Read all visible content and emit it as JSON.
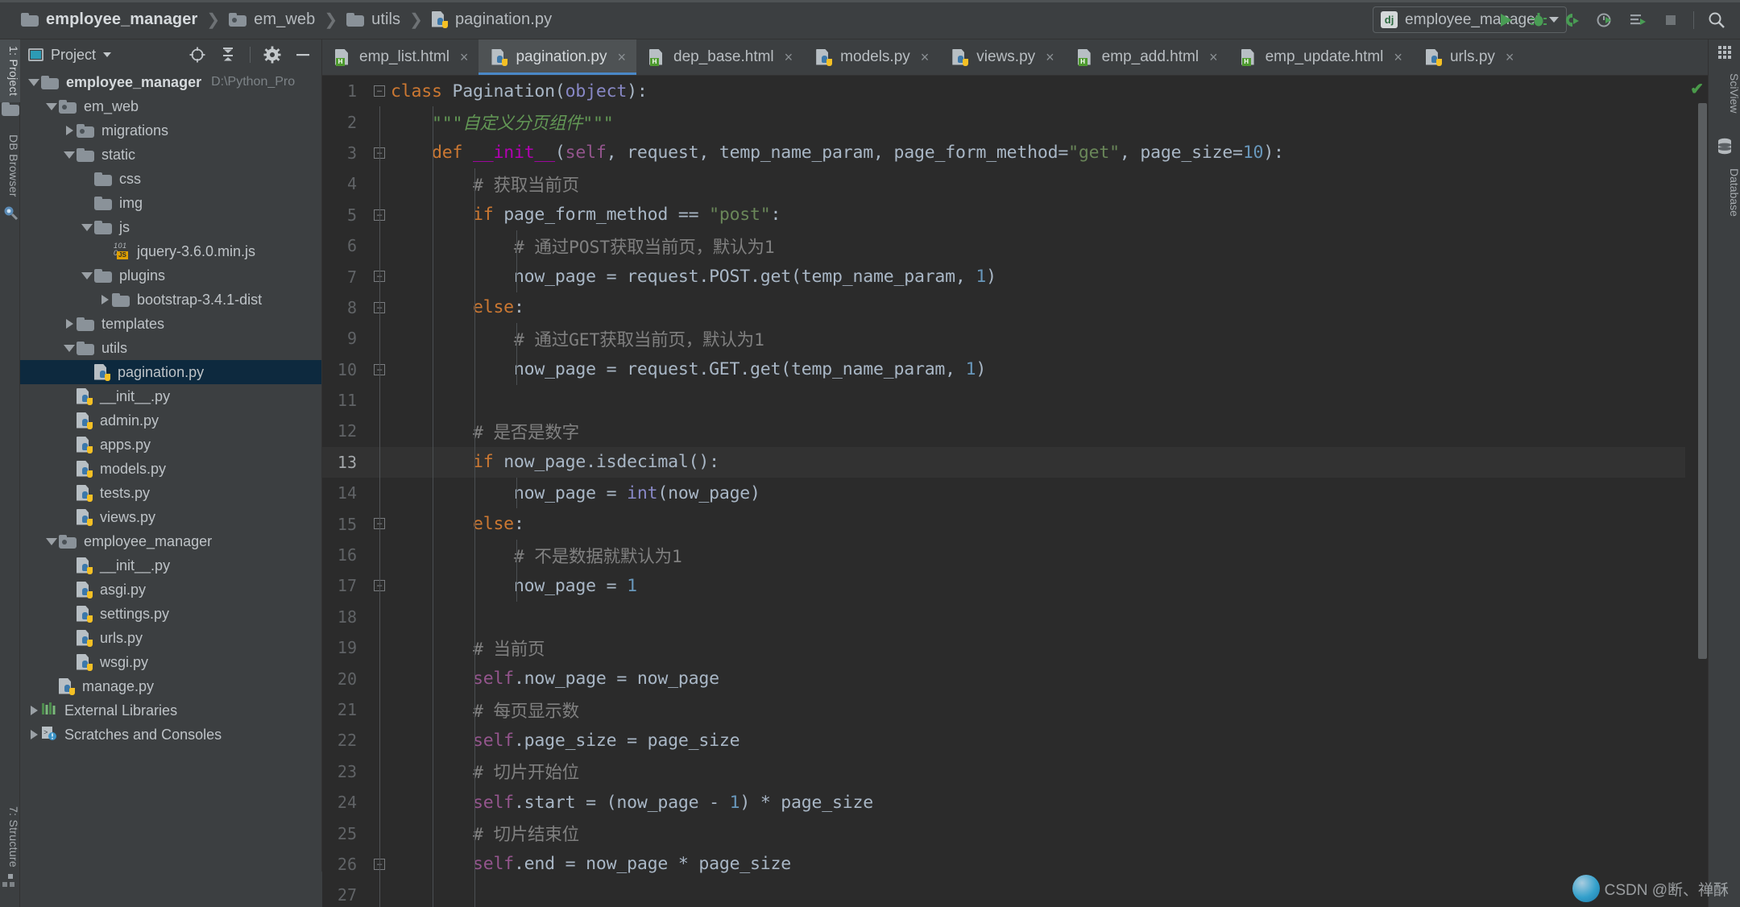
{
  "breadcrumb": {
    "items": [
      {
        "label": "employee_manager",
        "icon": "folder-icon"
      },
      {
        "label": "em_web",
        "icon": "module-folder-icon"
      },
      {
        "label": "utils",
        "icon": "folder-icon"
      },
      {
        "label": "pagination.py",
        "icon": "python-file-icon"
      }
    ],
    "separator": "❯"
  },
  "toolbar": {
    "run_config": {
      "badge": "dj",
      "name": "employee_manager",
      "dropdown": "▼"
    },
    "buttons": [
      {
        "name": "run-button",
        "glyph": "run"
      },
      {
        "name": "debug-button",
        "glyph": "debug"
      },
      {
        "name": "run-coverage-button",
        "glyph": "coverage"
      },
      {
        "name": "profile-button",
        "glyph": "profile"
      },
      {
        "name": "run-with-console-button",
        "glyph": "console"
      },
      {
        "name": "stop-button",
        "glyph": "stop"
      },
      {
        "name": "search-everywhere-button",
        "glyph": "search"
      }
    ]
  },
  "left_rail": {
    "top": [
      {
        "label": "1: Project",
        "active": true,
        "icon": "folder-icon"
      }
    ],
    "second": [
      {
        "label": "DB Browser",
        "active": false,
        "icon": "db-browser-icon"
      }
    ],
    "bottom": [
      {
        "label": "7: Structure",
        "active": false,
        "icon": "structure-icon"
      }
    ]
  },
  "right_rail": {
    "items": [
      {
        "label": "SciView",
        "icon": "grid-icon"
      },
      {
        "label": "Database",
        "icon": "database-icon"
      }
    ]
  },
  "project_panel": {
    "title": "Project",
    "dropdown": "▼",
    "tools": [
      {
        "name": "select-opened-file-icon",
        "glyph": "target"
      },
      {
        "name": "collapse-all-icon",
        "glyph": "collapse"
      },
      {
        "name": "settings-gear-icon",
        "glyph": "gear"
      },
      {
        "name": "hide-panel-icon",
        "glyph": "minus"
      }
    ],
    "tree": [
      {
        "label": "employee_manager",
        "path": "D:\\Python_Pro",
        "indent": 0,
        "twisty": "down",
        "icon": "folder-icon",
        "bold": true,
        "selected": false
      },
      {
        "label": "em_web",
        "path": "",
        "indent": 1,
        "twisty": "down",
        "icon": "module-folder-icon",
        "bold": false,
        "selected": false
      },
      {
        "label": "migrations",
        "path": "",
        "indent": 2,
        "twisty": "right",
        "icon": "module-folder-icon",
        "bold": false,
        "selected": false
      },
      {
        "label": "static",
        "path": "",
        "indent": 2,
        "twisty": "down",
        "icon": "folder-icon",
        "bold": false,
        "selected": false
      },
      {
        "label": "css",
        "path": "",
        "indent": 3,
        "twisty": "none",
        "icon": "folder-icon",
        "bold": false,
        "selected": false
      },
      {
        "label": "img",
        "path": "",
        "indent": 3,
        "twisty": "none",
        "icon": "folder-icon",
        "bold": false,
        "selected": false
      },
      {
        "label": "js",
        "path": "",
        "indent": 3,
        "twisty": "down",
        "icon": "folder-icon",
        "bold": false,
        "selected": false
      },
      {
        "label": "jquery-3.6.0.min.js",
        "path": "",
        "indent": 4,
        "twisty": "none",
        "icon": "js-file-icon",
        "bold": false,
        "selected": false
      },
      {
        "label": "plugins",
        "path": "",
        "indent": 3,
        "twisty": "down",
        "icon": "folder-icon",
        "bold": false,
        "selected": false
      },
      {
        "label": "bootstrap-3.4.1-dist",
        "path": "",
        "indent": 4,
        "twisty": "right",
        "icon": "folder-icon",
        "bold": false,
        "selected": false
      },
      {
        "label": "templates",
        "path": "",
        "indent": 2,
        "twisty": "right",
        "icon": "folder-icon",
        "bold": false,
        "selected": false
      },
      {
        "label": "utils",
        "path": "",
        "indent": 2,
        "twisty": "down",
        "icon": "folder-icon",
        "bold": false,
        "selected": false
      },
      {
        "label": "pagination.py",
        "path": "",
        "indent": 3,
        "twisty": "none",
        "icon": "python-file-icon",
        "bold": false,
        "selected": true
      },
      {
        "label": "__init__.py",
        "path": "",
        "indent": 2,
        "twisty": "none",
        "icon": "python-file-icon",
        "bold": false,
        "selected": false
      },
      {
        "label": "admin.py",
        "path": "",
        "indent": 2,
        "twisty": "none",
        "icon": "python-file-icon",
        "bold": false,
        "selected": false
      },
      {
        "label": "apps.py",
        "path": "",
        "indent": 2,
        "twisty": "none",
        "icon": "python-file-icon",
        "bold": false,
        "selected": false
      },
      {
        "label": "models.py",
        "path": "",
        "indent": 2,
        "twisty": "none",
        "icon": "python-file-icon",
        "bold": false,
        "selected": false
      },
      {
        "label": "tests.py",
        "path": "",
        "indent": 2,
        "twisty": "none",
        "icon": "python-file-icon",
        "bold": false,
        "selected": false
      },
      {
        "label": "views.py",
        "path": "",
        "indent": 2,
        "twisty": "none",
        "icon": "python-file-icon",
        "bold": false,
        "selected": false
      },
      {
        "label": "employee_manager",
        "path": "",
        "indent": 1,
        "twisty": "down",
        "icon": "module-folder-icon",
        "bold": false,
        "selected": false
      },
      {
        "label": "__init__.py",
        "path": "",
        "indent": 2,
        "twisty": "none",
        "icon": "python-file-icon",
        "bold": false,
        "selected": false
      },
      {
        "label": "asgi.py",
        "path": "",
        "indent": 2,
        "twisty": "none",
        "icon": "python-file-icon",
        "bold": false,
        "selected": false
      },
      {
        "label": "settings.py",
        "path": "",
        "indent": 2,
        "twisty": "none",
        "icon": "python-file-icon",
        "bold": false,
        "selected": false
      },
      {
        "label": "urls.py",
        "path": "",
        "indent": 2,
        "twisty": "none",
        "icon": "python-file-icon",
        "bold": false,
        "selected": false
      },
      {
        "label": "wsgi.py",
        "path": "",
        "indent": 2,
        "twisty": "none",
        "icon": "python-file-icon",
        "bold": false,
        "selected": false
      },
      {
        "label": "manage.py",
        "path": "",
        "indent": 1,
        "twisty": "none",
        "icon": "python-file-icon",
        "bold": false,
        "selected": false
      },
      {
        "label": "External Libraries",
        "path": "",
        "indent": 0,
        "twisty": "right",
        "icon": "libraries-icon",
        "bold": false,
        "selected": false
      },
      {
        "label": "Scratches and Consoles",
        "path": "",
        "indent": 0,
        "twisty": "right",
        "icon": "scratches-icon",
        "bold": false,
        "selected": false
      }
    ]
  },
  "editor": {
    "tabs": [
      {
        "label": "emp_list.html",
        "icon": "html-file-icon",
        "active": false,
        "close": "×"
      },
      {
        "label": "pagination.py",
        "icon": "python-file-icon",
        "active": true,
        "close": "×"
      },
      {
        "label": "dep_base.html",
        "icon": "html-file-icon",
        "active": false,
        "close": "×"
      },
      {
        "label": "models.py",
        "icon": "python-file-icon",
        "active": false,
        "close": "×"
      },
      {
        "label": "views.py",
        "icon": "python-file-icon",
        "active": false,
        "close": "×"
      },
      {
        "label": "emp_add.html",
        "icon": "html-file-icon",
        "active": false,
        "close": "×"
      },
      {
        "label": "emp_update.html",
        "icon": "html-file-icon",
        "active": false,
        "close": "×"
      },
      {
        "label": "urls.py",
        "icon": "python-file-icon",
        "active": false,
        "close": "×"
      }
    ],
    "current_line": 13,
    "inspection_status": "ok",
    "code_lines": [
      {
        "n": 1,
        "fold": "minus",
        "indent": 0,
        "tokens": [
          {
            "t": "class ",
            "c": "kw"
          },
          {
            "t": "Pagination",
            "c": "cls"
          },
          {
            "t": "(",
            "c": "punc"
          },
          {
            "t": "object",
            "c": "bi"
          },
          {
            "t": "):",
            "c": "punc"
          }
        ]
      },
      {
        "n": 2,
        "fold": "",
        "indent": 1,
        "tokens": [
          {
            "t": "    \"\"\"自定义分页组件\"\"\"",
            "c": "doc"
          }
        ]
      },
      {
        "n": 3,
        "fold": "minus",
        "indent": 1,
        "tokens": [
          {
            "t": "    ",
            "c": "punc"
          },
          {
            "t": "def ",
            "c": "kw"
          },
          {
            "t": "__init__",
            "c": "magic"
          },
          {
            "t": "(",
            "c": "punc"
          },
          {
            "t": "self",
            "c": "self"
          },
          {
            "t": ", request, temp_name_param, page_form_method=",
            "c": "punc"
          },
          {
            "t": "\"get\"",
            "c": "str"
          },
          {
            "t": ", page_size=",
            "c": "punc"
          },
          {
            "t": "10",
            "c": "num"
          },
          {
            "t": "):",
            "c": "punc"
          }
        ]
      },
      {
        "n": 4,
        "fold": "",
        "indent": 2,
        "tokens": [
          {
            "t": "        # 获取当前页",
            "c": "cmt"
          }
        ]
      },
      {
        "n": 5,
        "fold": "minus",
        "indent": 2,
        "tokens": [
          {
            "t": "        ",
            "c": "punc"
          },
          {
            "t": "if ",
            "c": "kw"
          },
          {
            "t": "page_form_method == ",
            "c": "punc"
          },
          {
            "t": "\"post\"",
            "c": "str"
          },
          {
            "t": ":",
            "c": "punc"
          }
        ]
      },
      {
        "n": 6,
        "fold": "",
        "indent": 3,
        "tokens": [
          {
            "t": "            # 通过POST获取当前页，默认为1",
            "c": "cmt"
          }
        ]
      },
      {
        "n": 7,
        "fold": "up",
        "indent": 3,
        "tokens": [
          {
            "t": "            now_page = request.POST.get(temp_name_param, ",
            "c": "punc"
          },
          {
            "t": "1",
            "c": "num"
          },
          {
            "t": ")",
            "c": "punc"
          }
        ]
      },
      {
        "n": 8,
        "fold": "minus",
        "indent": 2,
        "tokens": [
          {
            "t": "        ",
            "c": "punc"
          },
          {
            "t": "else",
            "c": "kw"
          },
          {
            "t": ":",
            "c": "punc"
          }
        ]
      },
      {
        "n": 9,
        "fold": "",
        "indent": 3,
        "tokens": [
          {
            "t": "            # 通过GET获取当前页，默认为1",
            "c": "cmt"
          }
        ]
      },
      {
        "n": 10,
        "fold": "up",
        "indent": 3,
        "tokens": [
          {
            "t": "            now_page = request.GET.get(temp_name_param, ",
            "c": "punc"
          },
          {
            "t": "1",
            "c": "num"
          },
          {
            "t": ")",
            "c": "punc"
          }
        ]
      },
      {
        "n": 11,
        "fold": "",
        "indent": 2,
        "tokens": []
      },
      {
        "n": 12,
        "fold": "",
        "indent": 2,
        "tokens": [
          {
            "t": "        # 是否是数字",
            "c": "cmt"
          }
        ]
      },
      {
        "n": 13,
        "fold": "",
        "indent": 2,
        "tokens": [
          {
            "t": "        ",
            "c": "punc"
          },
          {
            "t": "if ",
            "c": "kw"
          },
          {
            "t": "now_page.isdecimal():",
            "c": "punc"
          }
        ]
      },
      {
        "n": 14,
        "fold": "",
        "indent": 3,
        "tokens": [
          {
            "t": "            now_page = ",
            "c": "punc"
          },
          {
            "t": "int",
            "c": "bi"
          },
          {
            "t": "(now_page)",
            "c": "punc"
          }
        ]
      },
      {
        "n": 15,
        "fold": "minus",
        "indent": 2,
        "tokens": [
          {
            "t": "        ",
            "c": "punc"
          },
          {
            "t": "else",
            "c": "kw"
          },
          {
            "t": ":",
            "c": "punc"
          }
        ]
      },
      {
        "n": 16,
        "fold": "",
        "indent": 3,
        "tokens": [
          {
            "t": "            # 不是数据就默认为1",
            "c": "cmt"
          }
        ]
      },
      {
        "n": 17,
        "fold": "up",
        "indent": 3,
        "tokens": [
          {
            "t": "            now_page = ",
            "c": "punc"
          },
          {
            "t": "1",
            "c": "num"
          }
        ]
      },
      {
        "n": 18,
        "fold": "",
        "indent": 2,
        "tokens": []
      },
      {
        "n": 19,
        "fold": "",
        "indent": 2,
        "tokens": [
          {
            "t": "        # 当前页",
            "c": "cmt"
          }
        ]
      },
      {
        "n": 20,
        "fold": "",
        "indent": 2,
        "tokens": [
          {
            "t": "        ",
            "c": "punc"
          },
          {
            "t": "self",
            "c": "self"
          },
          {
            "t": ".now_page = now_page",
            "c": "punc"
          }
        ]
      },
      {
        "n": 21,
        "fold": "",
        "indent": 2,
        "tokens": [
          {
            "t": "        # 每页显示数",
            "c": "cmt"
          }
        ]
      },
      {
        "n": 22,
        "fold": "",
        "indent": 2,
        "tokens": [
          {
            "t": "        ",
            "c": "punc"
          },
          {
            "t": "self",
            "c": "self"
          },
          {
            "t": ".page_size = page_size",
            "c": "punc"
          }
        ]
      },
      {
        "n": 23,
        "fold": "",
        "indent": 2,
        "tokens": [
          {
            "t": "        # 切片开始位",
            "c": "cmt"
          }
        ]
      },
      {
        "n": 24,
        "fold": "",
        "indent": 2,
        "tokens": [
          {
            "t": "        ",
            "c": "punc"
          },
          {
            "t": "self",
            "c": "self"
          },
          {
            "t": ".start = (now_page - ",
            "c": "punc"
          },
          {
            "t": "1",
            "c": "num"
          },
          {
            "t": ") * page_size",
            "c": "punc"
          }
        ]
      },
      {
        "n": 25,
        "fold": "",
        "indent": 2,
        "tokens": [
          {
            "t": "        # 切片结束位",
            "c": "cmt"
          }
        ]
      },
      {
        "n": 26,
        "fold": "up",
        "indent": 2,
        "tokens": [
          {
            "t": "        ",
            "c": "punc"
          },
          {
            "t": "self",
            "c": "self"
          },
          {
            "t": ".end = now_page * page_size",
            "c": "punc"
          }
        ]
      },
      {
        "n": 27,
        "fold": "",
        "indent": 2,
        "tokens": []
      }
    ]
  },
  "watermark": {
    "text": "CSDN @断、禅酥"
  },
  "colors": {
    "background": "#3c3f41",
    "editor_background": "#2b2b2b",
    "selection": "#0d293e",
    "accent": "#4a88c7",
    "run_green": "#499c54",
    "keyword": "#cc7832",
    "string": "#6a8759",
    "number": "#6897bb",
    "comment": "#808080",
    "docstring": "#629755",
    "self": "#94558d",
    "builtin": "#8888c6",
    "magic_method": "#b200b2"
  }
}
